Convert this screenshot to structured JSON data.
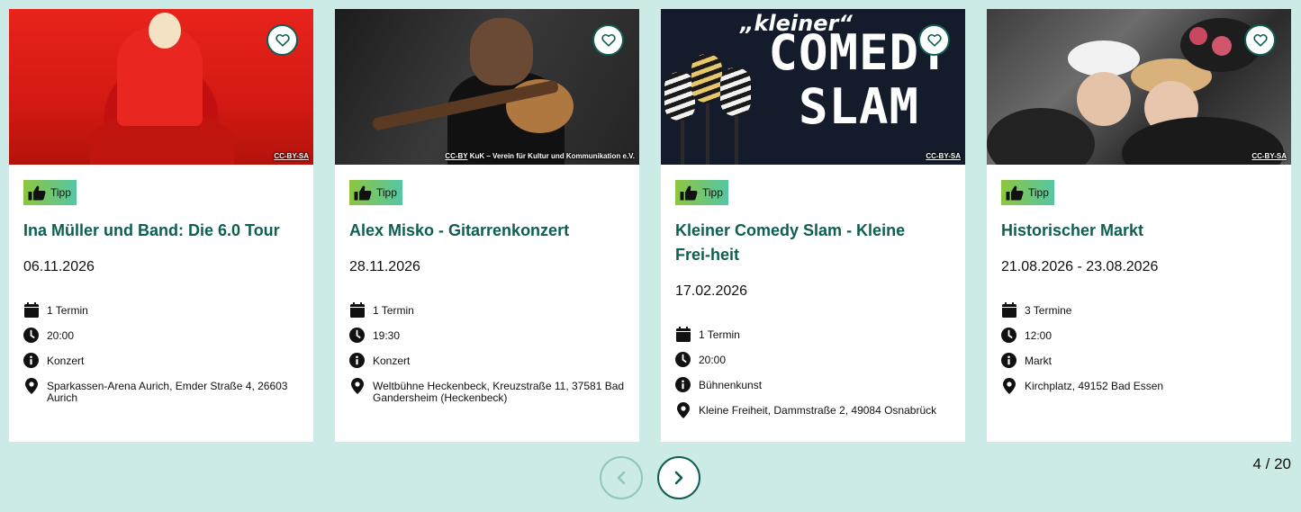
{
  "events": [
    {
      "credit": {
        "license": "CC-BY-SA",
        "author": ""
      },
      "badge": "Tipp",
      "title": "Ina Müller und Band: Die 6.0 Tour",
      "date": "06.11.2026",
      "termine": "1 Termin",
      "time": "20:00",
      "category": "Konzert",
      "location": "Sparkassen-Arena Aurich, Emder Straße 4, 26603 Aurich"
    },
    {
      "credit": {
        "license": "CC-BY",
        "author": "KuK – Verein für Kultur und Kommunikation e.V."
      },
      "badge": "Tipp",
      "title": "Alex Misko - Gitarrenkonzert",
      "date": "28.11.2026",
      "termine": "1 Termin",
      "time": "19:30",
      "category": "Konzert",
      "location": "Weltbühne Heckenbeck, Kreuzstraße 11, 37581 Bad Gandersheim (Heckenbeck)"
    },
    {
      "credit": {
        "license": "CC-BY-SA",
        "author": ""
      },
      "image_text": {
        "small": "„kleiner“",
        "big1": "COMEDY",
        "big2": "SLAM"
      },
      "badge": "Tipp",
      "title": "Kleiner Comedy Slam - Kleine Frei-heit",
      "date": "17.02.2026",
      "termine": "1 Termin",
      "time": "20:00",
      "category": "Bühnenkunst",
      "location": "Kleine Freiheit, Dammstraße 2, 49084 Osnabrück"
    },
    {
      "credit": {
        "license": "CC-BY-SA",
        "author": ""
      },
      "badge": "Tipp",
      "title": "Historischer Markt",
      "date": "21.08.2026 - 23.08.2026",
      "termine": "3 Termine",
      "time": "12:00",
      "category": "Markt",
      "location": "Kirchplatz, 49152 Bad Essen"
    }
  ],
  "pager": {
    "counter": "4 / 20"
  },
  "colors": {
    "background": "#cdebe6",
    "accent": "#0c5f52",
    "badge_start": "#8cc63f",
    "badge_end": "#56c6a4"
  },
  "icons": [
    "heart-icon",
    "thumbs-up-icon",
    "calendar-icon",
    "clock-icon",
    "info-icon",
    "location-pin-icon",
    "chevron-left-icon",
    "chevron-right-icon"
  ]
}
